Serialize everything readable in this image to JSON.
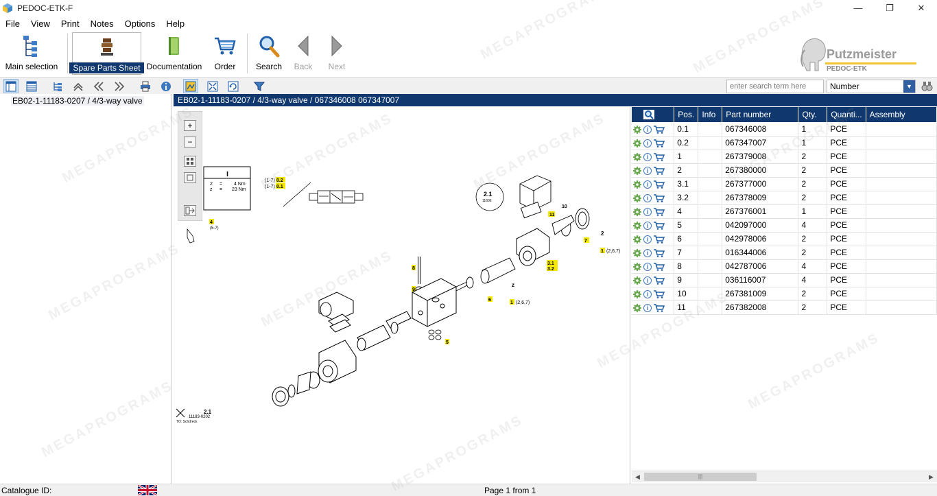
{
  "window": {
    "title": "PEDOC-ETK-F",
    "minimize": "—",
    "restore": "❐",
    "close": "✕"
  },
  "menu": [
    "File",
    "View",
    "Print",
    "Notes",
    "Options",
    "Help"
  ],
  "toolbar": {
    "main_selection": "Main selection",
    "spare_parts_sheet": "Spare Parts Sheet",
    "documentation": "Documentation",
    "order": "Order",
    "search": "Search",
    "back": "Back",
    "next": "Next"
  },
  "brand": {
    "name": "Putzmeister",
    "sub": "PEDOC-ETK",
    "logo_icon": "elephant-logo"
  },
  "search": {
    "placeholder": "enter search term here",
    "type": "Number"
  },
  "tree": {
    "node": "EB02-1-11183-0207  /  4/3-way valve"
  },
  "path": "EB02-1-11183-0207  /  4/3-way valve  /  067346008 067347007",
  "drawing": {
    "callouts": [
      "(1-7)",
      "0.2",
      "(1-7)",
      "0.1",
      "2",
      "=",
      "4 Nm",
      "z",
      "=",
      "23 Nm",
      "4",
      "(5-7)",
      "2.1",
      "11606",
      "11",
      "10",
      "7",
      "2",
      "1",
      "(2,6,7)",
      "3.1",
      "3.2",
      "8",
      "9",
      "z",
      "6",
      "1",
      "(2,6,7)",
      "5",
      "2.1",
      "11183-0202",
      "TO: Schdreck"
    ]
  },
  "table": {
    "headers": [
      "Pos.",
      "Info",
      "Part number",
      "Qty.",
      "Quanti...",
      "Assembly"
    ],
    "rows": [
      {
        "pos": "0.1",
        "part": "067346008",
        "qty": "1",
        "unit": "PCE"
      },
      {
        "pos": "0.2",
        "part": "067347007",
        "qty": "1",
        "unit": "PCE"
      },
      {
        "pos": "1",
        "part": "267379008",
        "qty": "2",
        "unit": "PCE"
      },
      {
        "pos": "2",
        "part": "267380000",
        "qty": "2",
        "unit": "PCE"
      },
      {
        "pos": "3.1",
        "part": "267377000",
        "qty": "2",
        "unit": "PCE"
      },
      {
        "pos": "3.2",
        "part": "267378009",
        "qty": "2",
        "unit": "PCE"
      },
      {
        "pos": "4",
        "part": "267376001",
        "qty": "1",
        "unit": "PCE"
      },
      {
        "pos": "5",
        "part": "042097000",
        "qty": "4",
        "unit": "PCE"
      },
      {
        "pos": "6",
        "part": "042978006",
        "qty": "2",
        "unit": "PCE"
      },
      {
        "pos": "7",
        "part": "016344006",
        "qty": "2",
        "unit": "PCE"
      },
      {
        "pos": "8",
        "part": "042787006",
        "qty": "4",
        "unit": "PCE"
      },
      {
        "pos": "9",
        "part": "036116007",
        "qty": "4",
        "unit": "PCE"
      },
      {
        "pos": "10",
        "part": "267381009",
        "qty": "2",
        "unit": "PCE"
      },
      {
        "pos": "11",
        "part": "267382008",
        "qty": "2",
        "unit": "PCE"
      }
    ]
  },
  "status": {
    "catalogue": "Catalogue ID:",
    "page": "Page 1 from 1",
    "flag_icon": "uk-flag-icon"
  },
  "watermark": "MEGAPROGRAMS",
  "colors": {
    "accent": "#10386e",
    "highlight": "#f5e800"
  }
}
